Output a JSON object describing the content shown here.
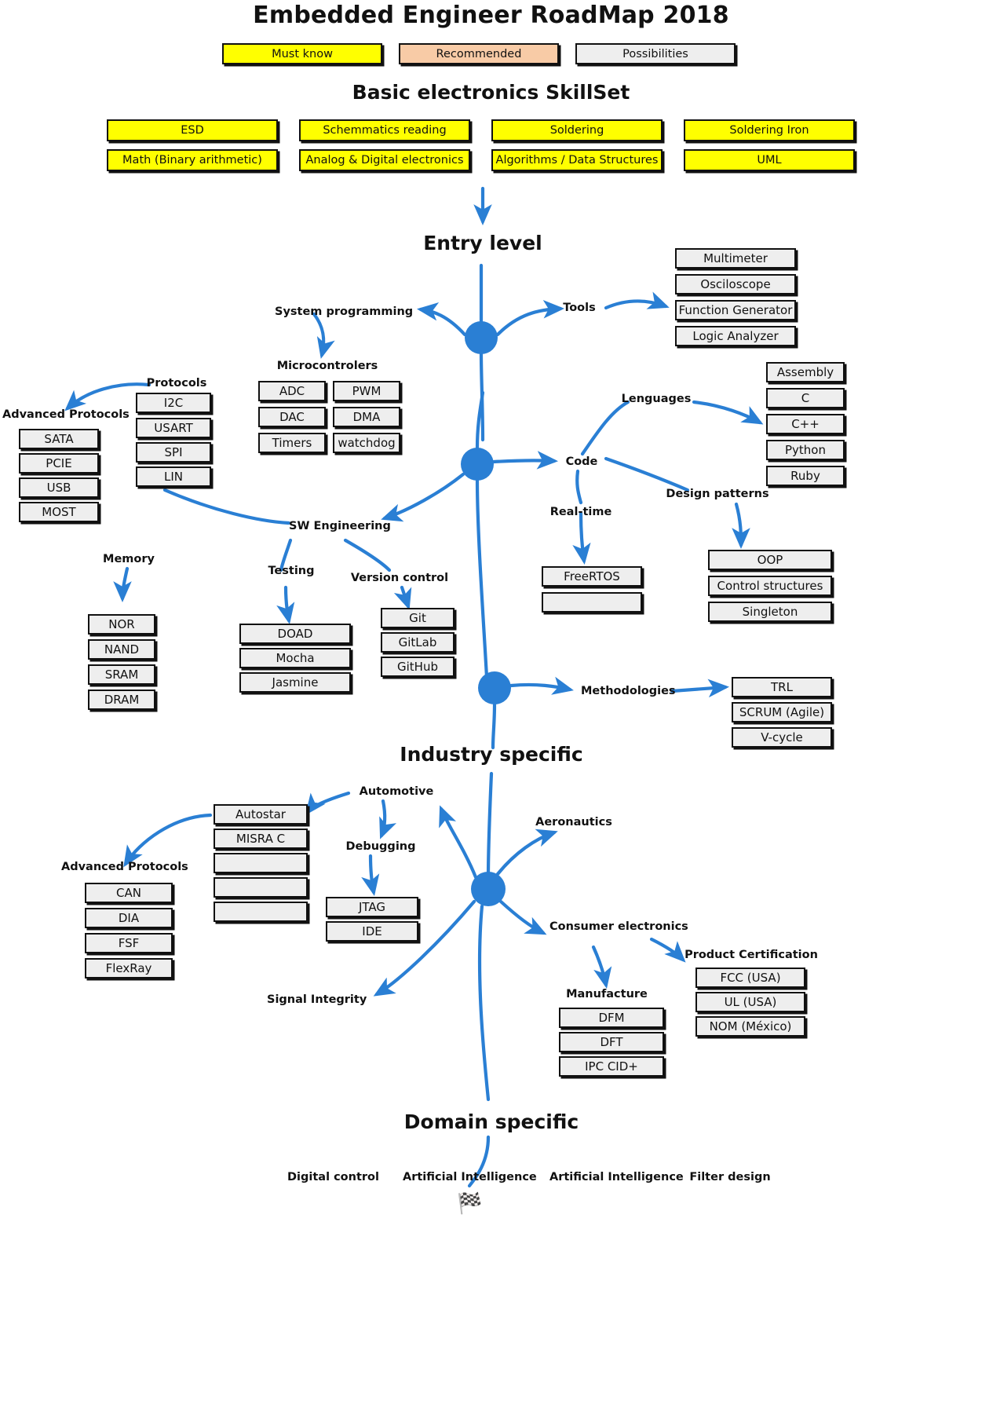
{
  "title": "Embedded Engineer RoadMap 2018",
  "legend": [
    {
      "label": "Must know",
      "style": "must",
      "color": "#ffff00"
    },
    {
      "label": "Recommended",
      "style": "rec",
      "color": "#f8cba6"
    },
    {
      "label": "Possibilities",
      "style": "pos",
      "color": "#eeeeee"
    }
  ],
  "sections": {
    "basic": "Basic electronics SkillSet",
    "entry": "Entry level",
    "industry": "Industry specific",
    "domain": "Domain specific"
  },
  "basic_skills": [
    {
      "label": "ESD",
      "style": "must"
    },
    {
      "label": "Schemmatics reading",
      "style": "must"
    },
    {
      "label": "Soldering",
      "style": "must"
    },
    {
      "label": "Soldering Iron",
      "style": "must"
    },
    {
      "label": "Math (Binary arithmetic)",
      "style": "must"
    },
    {
      "label": "Analog & Digital electronics",
      "style": "must"
    },
    {
      "label": "Algorithms / Data Structures",
      "style": "must"
    },
    {
      "label": "UML",
      "style": "must"
    }
  ],
  "branches": {
    "tools": {
      "label": "Tools",
      "items": [
        "Multimeter",
        "Osciloscope",
        "Function Generator",
        "Logic Analyzer"
      ]
    },
    "system_programming": {
      "label": "System programming"
    },
    "microcontrolers": {
      "label": "Microcontrolers",
      "items": [
        "ADC",
        "PWM",
        "DAC",
        "DMA",
        "Timers",
        "watchdog"
      ]
    },
    "protocols": {
      "label": "Protocols",
      "items": [
        "I2C",
        "USART",
        "SPI",
        "LIN"
      ]
    },
    "advanced_protocols_entry": {
      "label": "Advanced Protocols",
      "items": [
        "SATA",
        "PCIE",
        "USB",
        "MOST"
      ]
    },
    "code": {
      "label": "Code"
    },
    "lenguages": {
      "label": "Lenguages",
      "items": [
        "Assembly",
        "C",
        "C++",
        "Python",
        "Ruby"
      ]
    },
    "design_patterns": {
      "label": "Design patterns",
      "items": [
        "OOP",
        "Control structures",
        "Singleton"
      ]
    },
    "realtime": {
      "label": "Real-time",
      "items": [
        "FreeRTOS",
        ""
      ]
    },
    "sw_engineering": {
      "label": "SW Engineering"
    },
    "memory": {
      "label": "Memory",
      "items": [
        "NOR",
        "NAND",
        "SRAM",
        "DRAM"
      ]
    },
    "testing": {
      "label": "Testing",
      "items": [
        "DOAD",
        "Mocha",
        "Jasmine"
      ]
    },
    "version_control": {
      "label": "Version control",
      "items": [
        "Git",
        "GitLab",
        "GitHub"
      ]
    },
    "methodologies": {
      "label": "Methodologies",
      "items": [
        "TRL",
        "SCRUM (Agile)",
        "V-cycle"
      ]
    },
    "automotive": {
      "label": "Automotive",
      "items": [
        "Autostar",
        "MISRA C",
        "",
        "",
        ""
      ]
    },
    "advanced_protocols_auto": {
      "label": "Advanced Protocols",
      "items": [
        "CAN",
        "DIA",
        "FSF",
        "FlexRay"
      ]
    },
    "debugging": {
      "label": "Debugging",
      "items": [
        "JTAG",
        "IDE"
      ]
    },
    "aeronautics": {
      "label": "Aeronautics"
    },
    "consumer_electronics": {
      "label": "Consumer electronics"
    },
    "manufacture": {
      "label": "Manufacture",
      "items": [
        "DFM",
        "DFT",
        "IPC CID+"
      ]
    },
    "product_certification": {
      "label": "Product Certification",
      "items": [
        "FCC (USA)",
        "UL (USA)",
        "NOM (México)"
      ]
    },
    "signal_integrity": {
      "label": "Signal Integrity"
    }
  },
  "domain_topics": [
    "Digital control",
    "Artificial Intelligence",
    "Artificial Intelligence",
    "Filter design"
  ],
  "footer_icon": "flag-icon",
  "colors": {
    "accent": "#2a7fd4",
    "must_know": "#ffff00",
    "recommended": "#f8cba6",
    "possibilities": "#eeeeee",
    "outline": "#111111"
  }
}
